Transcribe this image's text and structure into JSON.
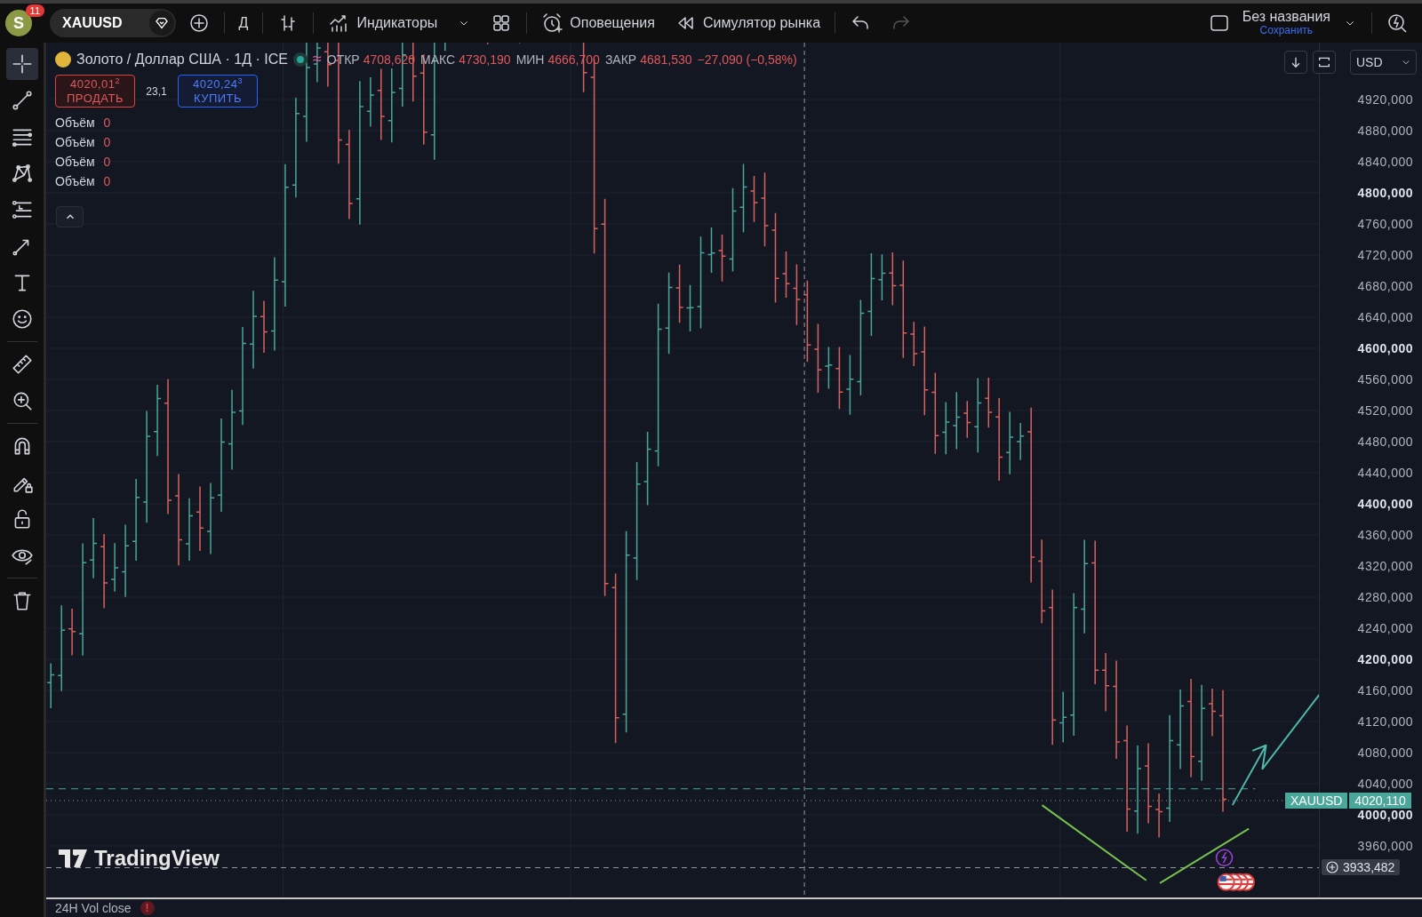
{
  "top_bar": {
    "avatar": {
      "initial": "S",
      "badge": "11"
    },
    "symbol": "XAUUSD",
    "toolbar": [
      {
        "kind": "add",
        "disabled": false
      },
      {
        "kind": "separator"
      },
      {
        "kind": "interval",
        "label": "Д",
        "disabled": false
      },
      {
        "kind": "separator"
      },
      {
        "kind": "chart-type",
        "disabled": false
      },
      {
        "kind": "separator"
      },
      {
        "kind": "indicators",
        "label": "Индикаторы",
        "disabled": false
      },
      {
        "kind": "caret",
        "disabled": false
      },
      {
        "kind": "layouts",
        "disabled": false
      },
      {
        "kind": "separator"
      },
      {
        "kind": "alerts",
        "label": "Оповещения",
        "disabled": false
      },
      {
        "kind": "replay",
        "label": "Симулятор рынка",
        "disabled": false
      },
      {
        "kind": "separator"
      },
      {
        "kind": "undo",
        "disabled": false
      },
      {
        "kind": "redo",
        "disabled": true
      }
    ],
    "layout": {
      "title": "Без названия",
      "action": "Сохранить"
    }
  },
  "tools": [
    {
      "kind": "crosshair",
      "selected": true
    },
    {
      "kind": "trend-line",
      "selected": false
    },
    {
      "kind": "parallel-lines",
      "selected": false
    },
    {
      "kind": "pattern",
      "selected": false
    },
    {
      "kind": "horizontal-lines",
      "selected": false
    },
    {
      "kind": "arrow",
      "selected": false
    },
    {
      "kind": "text",
      "selected": false
    },
    {
      "kind": "smiley",
      "selected": false
    },
    {
      "kind": "divider"
    },
    {
      "kind": "ruler",
      "selected": false
    },
    {
      "kind": "zoom-in",
      "selected": false
    },
    {
      "kind": "divider"
    },
    {
      "kind": "magnet",
      "selected": false
    },
    {
      "kind": "pencil-lock",
      "selected": false
    },
    {
      "kind": "padlock",
      "selected": false
    },
    {
      "kind": "eye",
      "selected": false
    },
    {
      "kind": "divider"
    },
    {
      "kind": "trash",
      "selected": false
    }
  ],
  "legend": {
    "title": "Золото / Доллар США · 1Д · ICE",
    "approx": "≈",
    "ohlc": [
      {
        "label": "ОТКР",
        "value": "4708,620"
      },
      {
        "label": "МАКС",
        "value": "4730,190"
      },
      {
        "label": "МИН",
        "value": "4666,700"
      },
      {
        "label": "ЗАКР",
        "value": "4681,530"
      }
    ],
    "change": "−27,090 (−0,58%)"
  },
  "trade": {
    "sell": {
      "price": "4020,01$^{2}$",
      "label": "ПРОДАТЬ"
    },
    "spread": "23,1",
    "buy": {
      "price": "4020,24$^{3}$",
      "label": "КУПИТЬ"
    }
  },
  "volumes": [
    {
      "label": "Объём",
      "value": "0"
    },
    {
      "label": "Объём",
      "value": "0"
    },
    {
      "label": "Объём",
      "value": "0"
    },
    {
      "label": "Объём",
      "value": "0"
    }
  ],
  "currency": "USD",
  "price_axis": [
    {
      "label": "4920,000",
      "major": false
    },
    {
      "label": "4880,000",
      "major": false
    },
    {
      "label": "4840,000",
      "major": false
    },
    {
      "label": "4800,000",
      "major": true
    },
    {
      "label": "4760,000",
      "major": false
    },
    {
      "label": "4720,000",
      "major": false
    },
    {
      "label": "4680,000",
      "major": false
    },
    {
      "label": "4640,000",
      "major": false
    },
    {
      "label": "4600,000",
      "major": true
    },
    {
      "label": "4560,000",
      "major": false
    },
    {
      "label": "4520,000",
      "major": false
    },
    {
      "label": "4480,000",
      "major": false
    },
    {
      "label": "4440,000",
      "major": false
    },
    {
      "label": "4400,000",
      "major": true
    },
    {
      "label": "4360,000",
      "major": false
    },
    {
      "label": "4320,000",
      "major": false
    },
    {
      "label": "4280,000",
      "major": false
    },
    {
      "label": "4240,000",
      "major": false
    },
    {
      "label": "4200,000",
      "major": true
    },
    {
      "label": "4160,000",
      "major": false
    },
    {
      "label": "4120,000",
      "major": false
    },
    {
      "label": "4080,000",
      "major": false
    },
    {
      "label": "4040,000",
      "major": false
    },
    {
      "label": "4000,000",
      "major": true
    },
    {
      "label": "3960,000",
      "major": false
    }
  ],
  "last_price": {
    "symbol": "XAUUSD",
    "price": "4020,110"
  },
  "crosshair_price": "3933,482",
  "logo": "TradingView",
  "bottom_panel": {
    "title": "24H Vol close",
    "alert": "!"
  }
}
